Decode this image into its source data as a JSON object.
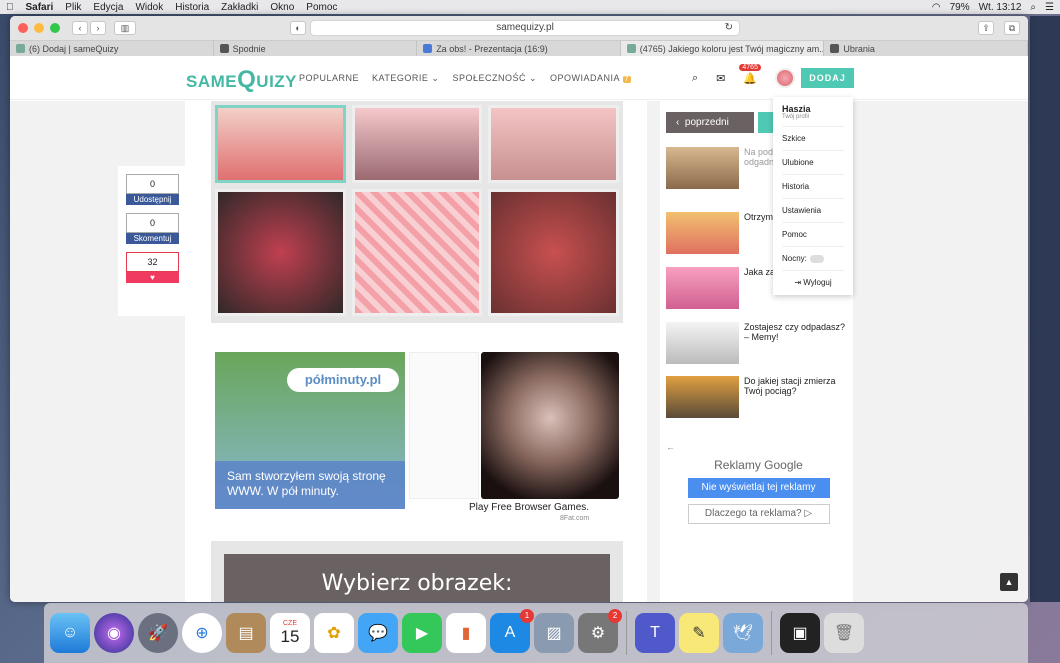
{
  "menubar": {
    "apple": "",
    "app": "Safari",
    "items": [
      "Plik",
      "Edycja",
      "Widok",
      "Historia",
      "Zakładki",
      "Okno",
      "Pomoc"
    ],
    "battery": "79%",
    "clock": "Wt. 13:12"
  },
  "browser": {
    "url": "samequizy.pl",
    "tabs": [
      "(6) Dodaj | sameQuizy",
      "Spodnie",
      "Za obs! - Prezentacja (16:9)",
      "(4765) Jakiego koloru jest Twój magiczny am...",
      "Ubrania"
    ]
  },
  "site": {
    "logo_pre": "SAME",
    "logo_q": "Q",
    "logo_post": "UIZY",
    "nav": [
      "POPULARNE",
      "KATEGORIE",
      "SPOŁECZNOŚĆ",
      "OPOWIADANIA"
    ],
    "nav_badge": "7",
    "notif_count": "4765",
    "add_button": "DODAJ"
  },
  "share": {
    "share_count": "0",
    "share_label": "Udostępnij",
    "comment_count": "0",
    "comment_label": "Skomentuj",
    "like_count": "32"
  },
  "ad": {
    "brand": "półminuty.pl",
    "slogan": "Sam stworzyłem swoją stronę WWW. W pół minuty.",
    "caption": "Play Free Browser Games.",
    "sub": "8Fat.com"
  },
  "pick_heading": "Wybierz obrazek:",
  "sidebar": {
    "prev": "poprzedni",
    "related": [
      "Na pod wyborów zwierz odgadn osobow",
      "Otrzym świade",
      "Jaka za dzieci stosun",
      "Zostajesz czy odpadasz? – Memy!",
      "Do jakiej stacji zmierza Twój pociąg?"
    ],
    "gads_title": "Reklamy Google",
    "gads_btn1": "Nie wyświetlaj tej reklamy",
    "gads_btn2": "Dlaczego ta reklama? ▷"
  },
  "dropdown": {
    "name": "Haszia",
    "sub": "Twój profil",
    "items": [
      "Szkice",
      "Ulubione",
      "Historia",
      "Ustawienia",
      "Pomoc"
    ],
    "night": "Nocny:",
    "logout": "Wyloguj"
  },
  "dock": {
    "calendar_month": "CZE",
    "calendar_day": "15",
    "appstore_badge": "1",
    "prefs_badge": "2"
  }
}
